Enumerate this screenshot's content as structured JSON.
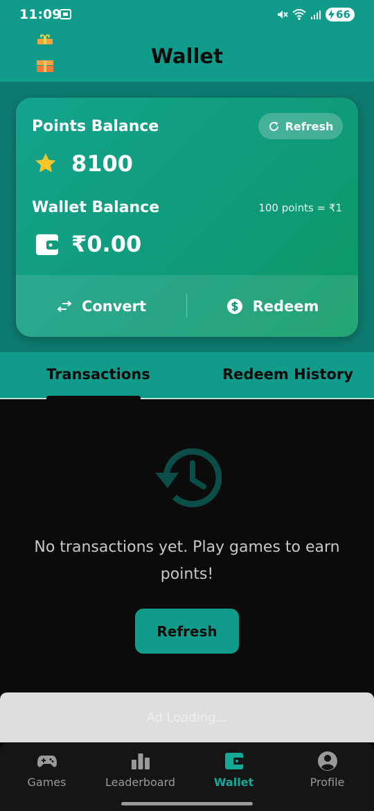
{
  "status": {
    "time": "11:09",
    "battery": "66"
  },
  "app": {
    "title": "Wallet"
  },
  "card": {
    "points_label": "Points Balance",
    "refresh_label": "Refresh",
    "points_value": "8100",
    "wallet_label": "Wallet Balance",
    "rate_text": "100 points = ₹1",
    "wallet_value": "₹0.00",
    "convert_label": "Convert",
    "redeem_label": "Redeem"
  },
  "tabs": [
    {
      "label": "Transactions",
      "active": true
    },
    {
      "label": "Redeem History",
      "active": false
    }
  ],
  "empty_state": {
    "message": "No transactions yet. Play games to earn points!",
    "button_label": "Refresh"
  },
  "ad": {
    "text": "Ad Loading..."
  },
  "nav": [
    {
      "label": "Games",
      "icon": "gamepad-icon",
      "active": false
    },
    {
      "label": "Leaderboard",
      "icon": "leaderboard-icon",
      "active": false
    },
    {
      "label": "Wallet",
      "icon": "wallet-icon",
      "active": true
    },
    {
      "label": "Profile",
      "icon": "profile-icon",
      "active": false
    }
  ],
  "colors": {
    "accent": "#119b8b",
    "dark": "#0b0b0b",
    "active_nav": "#17a796"
  }
}
